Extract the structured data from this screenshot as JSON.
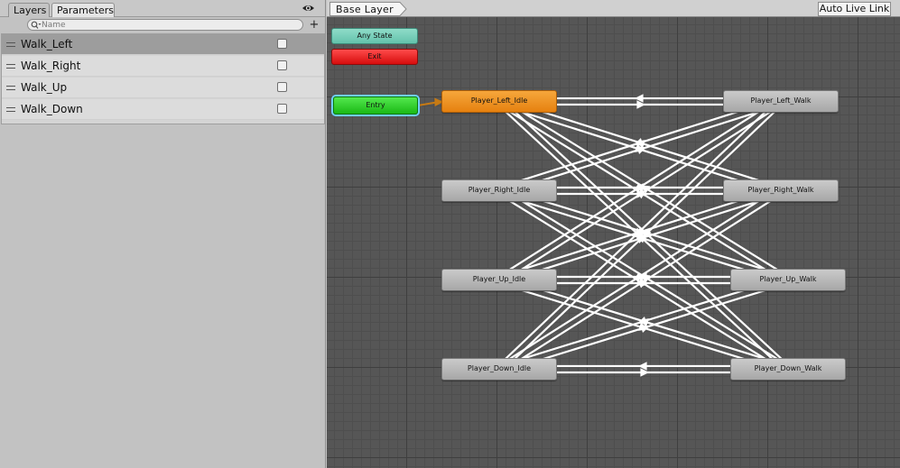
{
  "left_panel": {
    "tabs": [
      {
        "label": "Layers"
      },
      {
        "label": "Parameters"
      }
    ],
    "search": {
      "placeholder": "Name"
    },
    "add_button_label": "+",
    "parameters": [
      {
        "name": "Walk_Left",
        "type": "bool",
        "value": false,
        "selected": true
      },
      {
        "name": "Walk_Right",
        "type": "bool",
        "value": false,
        "selected": false
      },
      {
        "name": "Walk_Up",
        "type": "bool",
        "value": false,
        "selected": false
      },
      {
        "name": "Walk_Down",
        "type": "bool",
        "value": false,
        "selected": false
      }
    ]
  },
  "graph": {
    "breadcrumb": "Base Layer",
    "auto_live_link_label": "Auto Live Link",
    "states": {
      "any_state": "Any State",
      "exit": "Exit",
      "entry": "Entry",
      "player_left_idle": "Player_Left_Idle",
      "player_right_idle": "Player_Right_Idle",
      "player_up_idle": "Player_Up_Idle",
      "player_down_idle": "Player_Down_Idle",
      "player_left_walk": "Player_Left_Walk",
      "player_right_walk": "Player_Right_Walk",
      "player_up_walk": "Player_Up_Walk",
      "player_down_walk": "Player_Down_Walk"
    },
    "default_state": "player_left_idle",
    "transitions": [
      [
        "entry",
        "player_left_idle"
      ],
      [
        "player_left_idle",
        "player_left_walk"
      ],
      [
        "player_left_walk",
        "player_left_idle"
      ],
      [
        "player_right_idle",
        "player_right_walk"
      ],
      [
        "player_right_walk",
        "player_right_idle"
      ],
      [
        "player_up_idle",
        "player_up_walk"
      ],
      [
        "player_up_walk",
        "player_up_idle"
      ],
      [
        "player_down_idle",
        "player_down_walk"
      ],
      [
        "player_down_walk",
        "player_down_idle"
      ],
      [
        "player_left_idle",
        "player_right_walk"
      ],
      [
        "player_left_idle",
        "player_up_walk"
      ],
      [
        "player_left_idle",
        "player_down_walk"
      ],
      [
        "player_right_idle",
        "player_left_walk"
      ],
      [
        "player_right_idle",
        "player_up_walk"
      ],
      [
        "player_right_idle",
        "player_down_walk"
      ],
      [
        "player_up_idle",
        "player_left_walk"
      ],
      [
        "player_up_idle",
        "player_right_walk"
      ],
      [
        "player_up_idle",
        "player_down_walk"
      ],
      [
        "player_down_idle",
        "player_left_walk"
      ],
      [
        "player_down_idle",
        "player_right_walk"
      ],
      [
        "player_down_idle",
        "player_up_walk"
      ],
      [
        "player_left_walk",
        "player_right_idle"
      ],
      [
        "player_left_walk",
        "player_up_idle"
      ],
      [
        "player_left_walk",
        "player_down_idle"
      ],
      [
        "player_right_walk",
        "player_left_idle"
      ],
      [
        "player_right_walk",
        "player_up_idle"
      ],
      [
        "player_right_walk",
        "player_down_idle"
      ],
      [
        "player_up_walk",
        "player_left_idle"
      ],
      [
        "player_up_walk",
        "player_right_idle"
      ],
      [
        "player_up_walk",
        "player_down_idle"
      ],
      [
        "player_down_walk",
        "player_left_idle"
      ],
      [
        "player_down_walk",
        "player_right_idle"
      ],
      [
        "player_down_walk",
        "player_up_idle"
      ]
    ]
  },
  "colors": {
    "default_state": "#f0961f",
    "entry_state": "#2bd126",
    "any_state": "#7fd3bf",
    "exit_state": "#ee1c1c",
    "state": "#b9b9b9",
    "transition": "#ffffff",
    "entry_transition": "#c67a14",
    "canvas": "#565656"
  },
  "icons": {
    "visibility": "eye-icon",
    "search": "search-icon",
    "drag": "drag-handle-icon"
  }
}
